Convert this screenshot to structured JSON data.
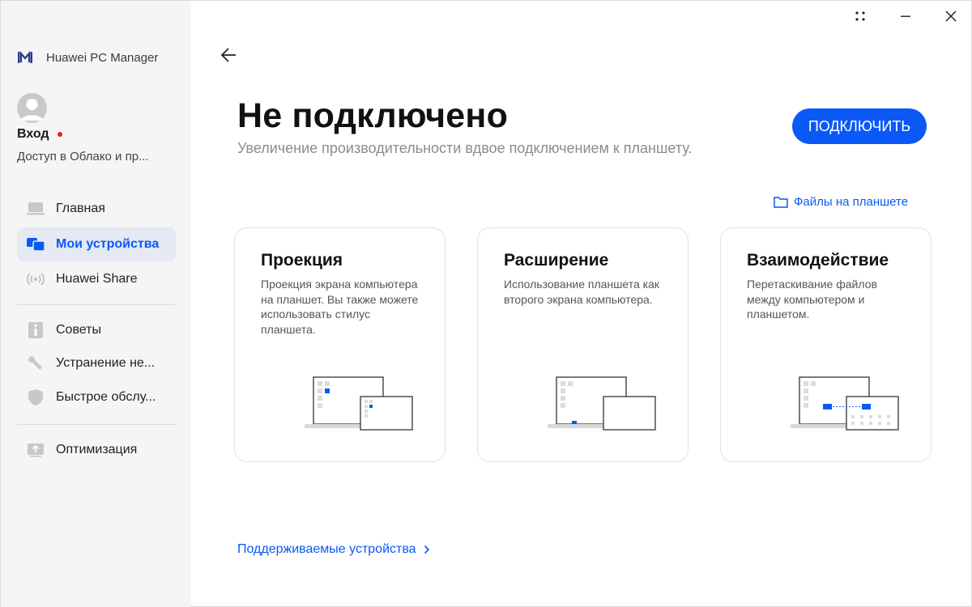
{
  "app": {
    "title": "Huawei PC Manager"
  },
  "account": {
    "login_label": "Вход",
    "subtitle": "Доступ в Облако и пр..."
  },
  "sidebar": {
    "items": [
      {
        "label": "Главная",
        "icon": "laptop-icon"
      },
      {
        "label": "Мои устройства",
        "icon": "devices-icon",
        "active": true
      },
      {
        "label": "Huawei Share",
        "icon": "share-wireless-icon"
      },
      {
        "label": "Советы",
        "icon": "tips-icon"
      },
      {
        "label": "Устранение не...",
        "icon": "wrench-icon"
      },
      {
        "label": "Быстрое обслу...",
        "icon": "shield-icon"
      },
      {
        "label": "Оптимизация",
        "icon": "optimize-icon"
      }
    ]
  },
  "main": {
    "title": "Не подключено",
    "subtitle": "Увеличение производительности вдвое подключением к планшету.",
    "connect_label": "ПОДКЛЮЧИТЬ",
    "files_link": "Файлы на планшете",
    "cards": [
      {
        "title": "Проекция",
        "desc": "Проекция экрана компьютера на планшет. Вы также можете использовать стилус планшета.",
        "icon": "projection-illustration"
      },
      {
        "title": "Расширение",
        "desc": "Использование планшета как второго экрана компьютера.",
        "icon": "extension-illustration"
      },
      {
        "title": "Взаимодействие",
        "desc": "Перетаскивание файлов между компьютером и планшетом.",
        "icon": "collaboration-illustration"
      }
    ],
    "supported_link": "Поддерживаемые устройства"
  },
  "colors": {
    "accent": "#0a59f7",
    "sidebar_bg": "#f5f5f5",
    "active_bg": "#e4e9f3",
    "alert_dot": "#e02020"
  }
}
